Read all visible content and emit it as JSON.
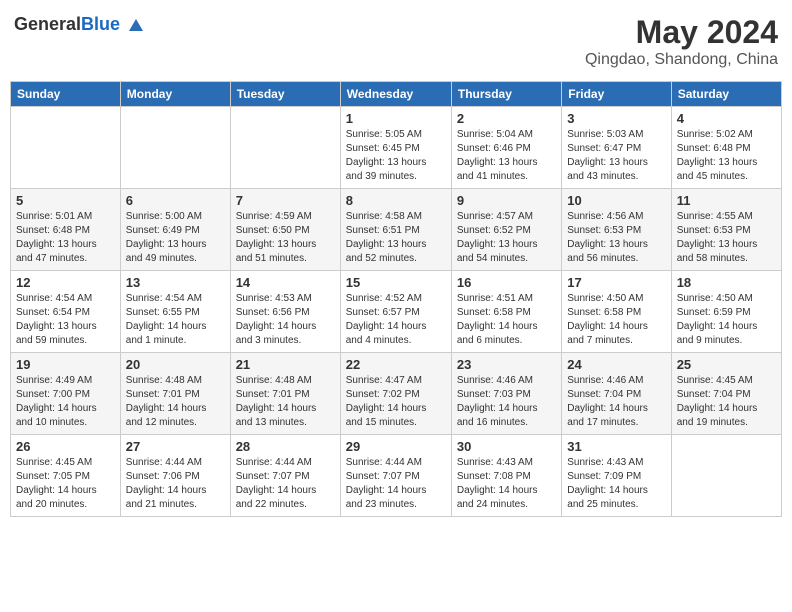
{
  "header": {
    "logo_general": "General",
    "logo_blue": "Blue",
    "month": "May 2024",
    "location": "Qingdao, Shandong, China"
  },
  "weekdays": [
    "Sunday",
    "Monday",
    "Tuesday",
    "Wednesday",
    "Thursday",
    "Friday",
    "Saturday"
  ],
  "weeks": [
    [
      {
        "day": "",
        "info": ""
      },
      {
        "day": "",
        "info": ""
      },
      {
        "day": "",
        "info": ""
      },
      {
        "day": "1",
        "info": "Sunrise: 5:05 AM\nSunset: 6:45 PM\nDaylight: 13 hours\nand 39 minutes."
      },
      {
        "day": "2",
        "info": "Sunrise: 5:04 AM\nSunset: 6:46 PM\nDaylight: 13 hours\nand 41 minutes."
      },
      {
        "day": "3",
        "info": "Sunrise: 5:03 AM\nSunset: 6:47 PM\nDaylight: 13 hours\nand 43 minutes."
      },
      {
        "day": "4",
        "info": "Sunrise: 5:02 AM\nSunset: 6:48 PM\nDaylight: 13 hours\nand 45 minutes."
      }
    ],
    [
      {
        "day": "5",
        "info": "Sunrise: 5:01 AM\nSunset: 6:48 PM\nDaylight: 13 hours\nand 47 minutes."
      },
      {
        "day": "6",
        "info": "Sunrise: 5:00 AM\nSunset: 6:49 PM\nDaylight: 13 hours\nand 49 minutes."
      },
      {
        "day": "7",
        "info": "Sunrise: 4:59 AM\nSunset: 6:50 PM\nDaylight: 13 hours\nand 51 minutes."
      },
      {
        "day": "8",
        "info": "Sunrise: 4:58 AM\nSunset: 6:51 PM\nDaylight: 13 hours\nand 52 minutes."
      },
      {
        "day": "9",
        "info": "Sunrise: 4:57 AM\nSunset: 6:52 PM\nDaylight: 13 hours\nand 54 minutes."
      },
      {
        "day": "10",
        "info": "Sunrise: 4:56 AM\nSunset: 6:53 PM\nDaylight: 13 hours\nand 56 minutes."
      },
      {
        "day": "11",
        "info": "Sunrise: 4:55 AM\nSunset: 6:53 PM\nDaylight: 13 hours\nand 58 minutes."
      }
    ],
    [
      {
        "day": "12",
        "info": "Sunrise: 4:54 AM\nSunset: 6:54 PM\nDaylight: 13 hours\nand 59 minutes."
      },
      {
        "day": "13",
        "info": "Sunrise: 4:54 AM\nSunset: 6:55 PM\nDaylight: 14 hours\nand 1 minute."
      },
      {
        "day": "14",
        "info": "Sunrise: 4:53 AM\nSunset: 6:56 PM\nDaylight: 14 hours\nand 3 minutes."
      },
      {
        "day": "15",
        "info": "Sunrise: 4:52 AM\nSunset: 6:57 PM\nDaylight: 14 hours\nand 4 minutes."
      },
      {
        "day": "16",
        "info": "Sunrise: 4:51 AM\nSunset: 6:58 PM\nDaylight: 14 hours\nand 6 minutes."
      },
      {
        "day": "17",
        "info": "Sunrise: 4:50 AM\nSunset: 6:58 PM\nDaylight: 14 hours\nand 7 minutes."
      },
      {
        "day": "18",
        "info": "Sunrise: 4:50 AM\nSunset: 6:59 PM\nDaylight: 14 hours\nand 9 minutes."
      }
    ],
    [
      {
        "day": "19",
        "info": "Sunrise: 4:49 AM\nSunset: 7:00 PM\nDaylight: 14 hours\nand 10 minutes."
      },
      {
        "day": "20",
        "info": "Sunrise: 4:48 AM\nSunset: 7:01 PM\nDaylight: 14 hours\nand 12 minutes."
      },
      {
        "day": "21",
        "info": "Sunrise: 4:48 AM\nSunset: 7:01 PM\nDaylight: 14 hours\nand 13 minutes."
      },
      {
        "day": "22",
        "info": "Sunrise: 4:47 AM\nSunset: 7:02 PM\nDaylight: 14 hours\nand 15 minutes."
      },
      {
        "day": "23",
        "info": "Sunrise: 4:46 AM\nSunset: 7:03 PM\nDaylight: 14 hours\nand 16 minutes."
      },
      {
        "day": "24",
        "info": "Sunrise: 4:46 AM\nSunset: 7:04 PM\nDaylight: 14 hours\nand 17 minutes."
      },
      {
        "day": "25",
        "info": "Sunrise: 4:45 AM\nSunset: 7:04 PM\nDaylight: 14 hours\nand 19 minutes."
      }
    ],
    [
      {
        "day": "26",
        "info": "Sunrise: 4:45 AM\nSunset: 7:05 PM\nDaylight: 14 hours\nand 20 minutes."
      },
      {
        "day": "27",
        "info": "Sunrise: 4:44 AM\nSunset: 7:06 PM\nDaylight: 14 hours\nand 21 minutes."
      },
      {
        "day": "28",
        "info": "Sunrise: 4:44 AM\nSunset: 7:07 PM\nDaylight: 14 hours\nand 22 minutes."
      },
      {
        "day": "29",
        "info": "Sunrise: 4:44 AM\nSunset: 7:07 PM\nDaylight: 14 hours\nand 23 minutes."
      },
      {
        "day": "30",
        "info": "Sunrise: 4:43 AM\nSunset: 7:08 PM\nDaylight: 14 hours\nand 24 minutes."
      },
      {
        "day": "31",
        "info": "Sunrise: 4:43 AM\nSunset: 7:09 PM\nDaylight: 14 hours\nand 25 minutes."
      },
      {
        "day": "",
        "info": ""
      }
    ]
  ]
}
